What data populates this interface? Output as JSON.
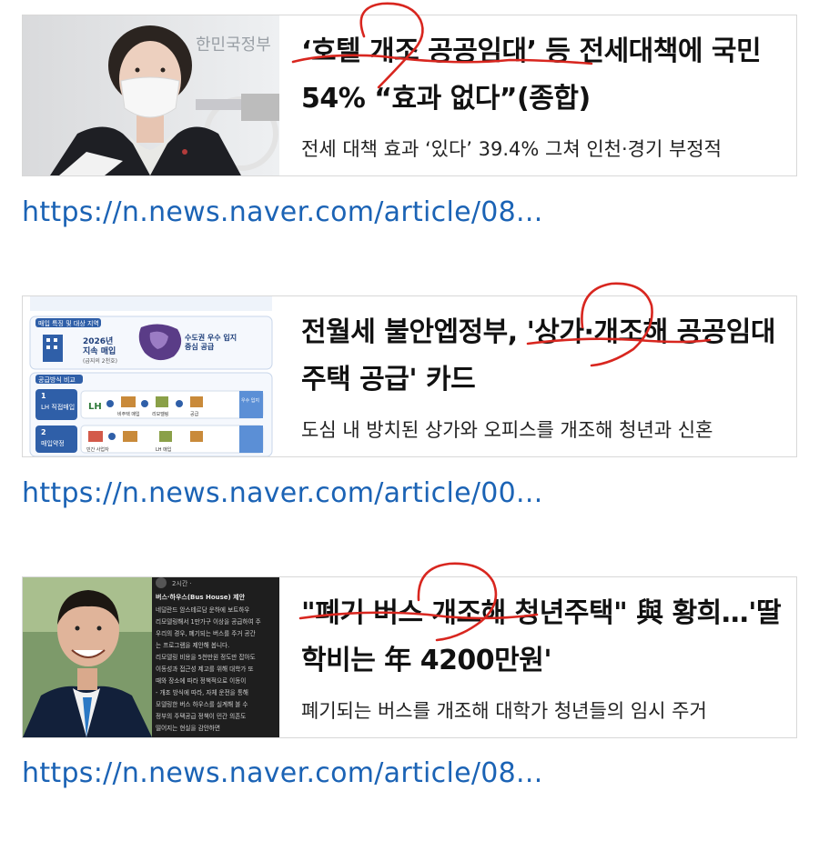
{
  "articles": [
    {
      "title": "‘호텔 개조 공공임대’ 등 전세대책에 국민 54% “효과 없다”(종합)",
      "description": "전세 대책 효과 ‘있다’ 39.4% 그쳐 인천·경기 부정적",
      "link": "https://n.news.naver.com/article/08...",
      "thumb": {
        "backdrop_text": "한민국정부",
        "icon": "person-at-podium-photo"
      }
    },
    {
      "title": "전월세 불안엡정부, '상가·개조해 공공임대주택 공급' 카드",
      "description": "도심 내 방치된 상가와 오피스를 개조해 청년과 신혼",
      "link": "https://n.news.naver.com/article/00...",
      "thumb": {
        "section1": "매입 특징 및 대상 지역",
        "year_label": "2026년",
        "year_sub": "지속 매입",
        "year_note": "(급지의 2천호)",
        "region_line1": "수도권 우수 입지",
        "region_line2": "중심 공급",
        "section2": "공급방식 비교",
        "row1_num": "1",
        "row1_label": "LH 직접매입",
        "row2_num": "2",
        "row2_label": "매입약정",
        "lh_logo": "LH",
        "step_a": "비주택 매입",
        "step_b": "리모델링",
        "step_c": "공급",
        "side_note": "우수 입지",
        "bottom_a": "민간 사업자",
        "bottom_b": "LH 매입",
        "icon": "infographic"
      }
    },
    {
      "title": "\"폐기 버스 개조해 청년주택\" 與 황희…'딸 학비는 年 4200만원'",
      "description": "폐기되는 버스를 개조해 대학가 청년들의 임시 주거",
      "link": "https://n.news.naver.com/article/08...",
      "thumb": {
        "time": "2시간 ·",
        "heading": "버스·하우스(Bus House) 제안",
        "lines": [
          "네덜란드 암스테르담 운하에 보트하우",
          "리모델링해서 1만가구 이상을 공급하여 주",
          "우리의 경우, 폐기되는 버스를 주거 공간",
          "는 프로그램을 제안해 봅니다.",
          "리모델링 비용을 5천만원 정도만 잡아도",
          "이동성과 접근성 제고를 위해 대학가 또",
          "때와 장소에 따라 정책적으로 이동이",
          "- 개조 방식에 따라, 자체 운전을 통해",
          "모델링한 버스 하우스를 실계해 볼 수",
          "정부의 주택공급 정책이 민간 의존도",
          "떨어지는 현실을 감안하면"
        ],
        "icon": "person-photo"
      }
    }
  ]
}
